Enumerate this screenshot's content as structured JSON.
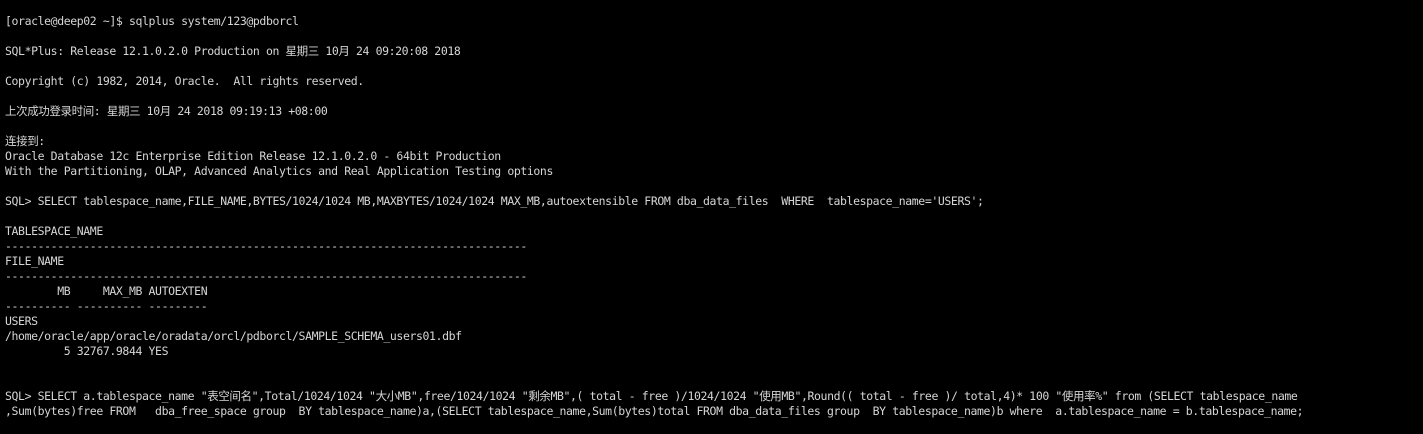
{
  "terminal": {
    "colors": {
      "background": "#000000",
      "foreground": "#d6d6d6"
    },
    "lines": [
      "[oracle@deep02 ~]$ sqlplus system/123@pdborcl",
      "",
      "SQL*Plus: Release 12.1.0.2.0 Production on 星期三 10月 24 09:20:08 2018",
      "",
      "Copyright (c) 1982, 2014, Oracle.  All rights reserved.",
      "",
      "上次成功登录时间: 星期三 10月 24 2018 09:19:13 +08:00",
      "",
      "连接到:",
      "Oracle Database 12c Enterprise Edition Release 12.1.0.2.0 - 64bit Production",
      "With the Partitioning, OLAP, Advanced Analytics and Real Application Testing options",
      "",
      "SQL> SELECT tablespace_name,FILE_NAME,BYTES/1024/1024 MB,MAXBYTES/1024/1024 MAX_MB,autoextensible FROM dba_data_files  WHERE  tablespace_name='USERS';",
      "",
      "TABLESPACE_NAME",
      "--------------------------------------------------------------------------------",
      "FILE_NAME",
      "--------------------------------------------------------------------------------",
      "        MB     MAX_MB AUTOEXTEN",
      "---------- ---------- ---------",
      "USERS",
      "/home/oracle/app/oracle/oradata/orcl/pdborcl/SAMPLE_SCHEMA_users01.dbf",
      "         5 32767.9844 YES",
      "",
      "",
      "SQL> SELECT a.tablespace_name \"表空间名\",Total/1024/1024 \"大小MB\",free/1024/1024 \"剩余MB\",( total - free )/1024/1024 \"使用MB\",Round(( total - free )/ total,4)* 100 \"使用率%\" from (SELECT tablespace_name",
      ",Sum(bytes)free FROM   dba_free_space group  BY tablespace_name)a,(SELECT tablespace_name,Sum(bytes)total FROM dba_data_files group  BY tablespace_name)b where  a.tablespace_name = b.tablespace_name;"
    ]
  }
}
